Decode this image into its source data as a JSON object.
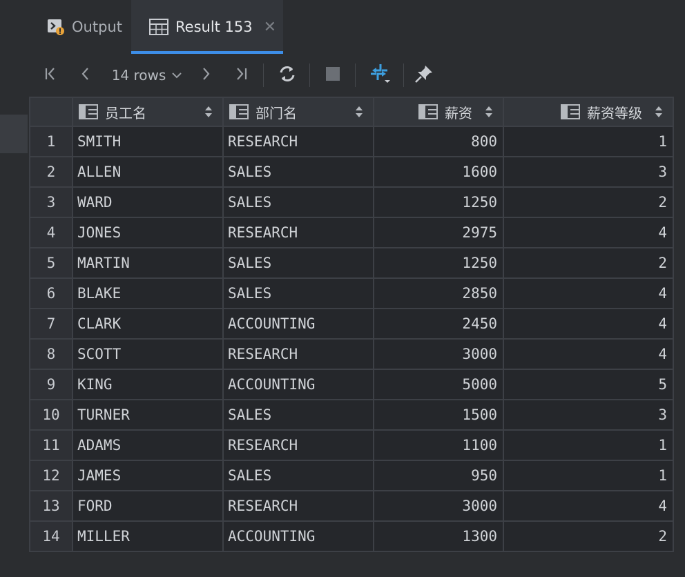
{
  "tabs": {
    "output_label": "Output",
    "result_label": "Result 153"
  },
  "toolbar": {
    "rows_label": "14 rows"
  },
  "colors": {
    "accent": "#3d8ee8",
    "background": "#2b2d30",
    "cell_bg": "#25272b"
  },
  "icons": [
    "output-icon",
    "table-icon",
    "close-icon",
    "first-page-icon",
    "prev-page-icon",
    "chevron-down-icon",
    "next-page-icon",
    "last-page-icon",
    "refresh-icon",
    "stop-icon",
    "compare-icon",
    "pin-icon",
    "column-icon",
    "sort-icon"
  ],
  "table": {
    "columns": [
      "员工名",
      "部门名",
      "薪资",
      "薪资等级"
    ],
    "rows": [
      {
        "n": "1",
        "name": "SMITH",
        "dept": "RESEARCH",
        "sal": "800",
        "grade": "1"
      },
      {
        "n": "2",
        "name": "ALLEN",
        "dept": "SALES",
        "sal": "1600",
        "grade": "3"
      },
      {
        "n": "3",
        "name": "WARD",
        "dept": "SALES",
        "sal": "1250",
        "grade": "2"
      },
      {
        "n": "4",
        "name": "JONES",
        "dept": "RESEARCH",
        "sal": "2975",
        "grade": "4"
      },
      {
        "n": "5",
        "name": "MARTIN",
        "dept": "SALES",
        "sal": "1250",
        "grade": "2"
      },
      {
        "n": "6",
        "name": "BLAKE",
        "dept": "SALES",
        "sal": "2850",
        "grade": "4"
      },
      {
        "n": "7",
        "name": "CLARK",
        "dept": "ACCOUNTING",
        "sal": "2450",
        "grade": "4"
      },
      {
        "n": "8",
        "name": "SCOTT",
        "dept": "RESEARCH",
        "sal": "3000",
        "grade": "4"
      },
      {
        "n": "9",
        "name": "KING",
        "dept": "ACCOUNTING",
        "sal": "5000",
        "grade": "5"
      },
      {
        "n": "10",
        "name": "TURNER",
        "dept": "SALES",
        "sal": "1500",
        "grade": "3"
      },
      {
        "n": "11",
        "name": "ADAMS",
        "dept": "RESEARCH",
        "sal": "1100",
        "grade": "1"
      },
      {
        "n": "12",
        "name": "JAMES",
        "dept": "SALES",
        "sal": "950",
        "grade": "1"
      },
      {
        "n": "13",
        "name": "FORD",
        "dept": "RESEARCH",
        "sal": "3000",
        "grade": "4"
      },
      {
        "n": "14",
        "name": "MILLER",
        "dept": "ACCOUNTING",
        "sal": "1300",
        "grade": "2"
      }
    ]
  }
}
